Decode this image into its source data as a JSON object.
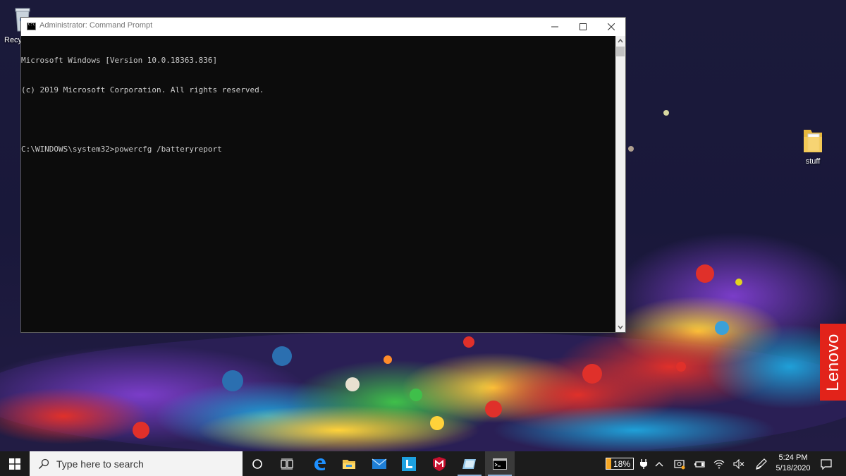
{
  "desktop": {
    "icons": [
      {
        "label": "Recy"
      },
      {
        "label": "stuff"
      }
    ],
    "brand_tag": "Lenovo"
  },
  "cmd": {
    "title": "Administrator: Command Prompt",
    "lines": [
      "Microsoft Windows [Version 10.0.18363.836]",
      "(c) 2019 Microsoft Corporation. All rights reserved.",
      "",
      "C:\\WINDOWS\\system32>powercfg /batteryreport"
    ]
  },
  "taskbar": {
    "search_placeholder": "Type here to search",
    "apps": [
      "cortana-icon",
      "task-view-icon",
      "edge-icon",
      "file-explorer-icon",
      "mail-icon",
      "l-app-icon",
      "mcafee-icon",
      "pen-app-icon",
      "cmd-icon"
    ],
    "battery_percent": "18%",
    "time": "5:24 PM",
    "date": "5/18/2020"
  },
  "colors": {
    "console_bg": "#0c0c0c",
    "console_text": "#cccccc",
    "taskbar_bg": "#1c1c1c",
    "lenovo_red": "#e2231a",
    "battery_fill": "#f5a623"
  }
}
